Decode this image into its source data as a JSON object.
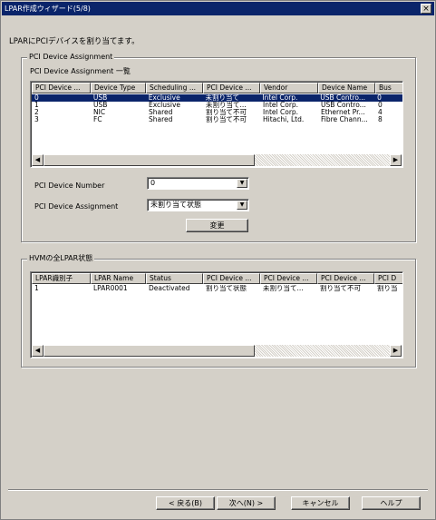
{
  "window": {
    "title": "LPAR作成ウィザード(5/8)",
    "close_glyph": "×"
  },
  "instruction": "LPARにPCIデバイスを割り当てます。",
  "pci_group": {
    "title": "PCI Device Assignment",
    "list_caption": "PCI Device Assignment 一覧",
    "columns": [
      "PCI Device ...",
      "Device Type",
      "Scheduling ...",
      "PCI Device ...",
      "Vendor",
      "Device Name",
      "Bus"
    ],
    "rows": [
      [
        "0",
        "USB",
        "Exclusive",
        "未割り当て",
        "Intel Corp.",
        "USB Contro...",
        "0"
      ],
      [
        "1",
        "USB",
        "Exclusive",
        "未割り当て...",
        "Intel Corp.",
        "USB Contro...",
        "0"
      ],
      [
        "2",
        "NIC",
        "Shared",
        "割り当て不可",
        "Intel Corp.",
        "Ethernet Pr...",
        "4"
      ],
      [
        "3",
        "FC",
        "Shared",
        "割り当て不可",
        "Hitachi, Ltd.",
        "Fibre Chann...",
        "8"
      ]
    ],
    "number_label": "PCI Device Number",
    "number_value": "0",
    "assignment_label": "PCI Device Assignment",
    "assignment_value": "未割り当て状態",
    "change_button": "変更"
  },
  "lpar_group": {
    "title": "HVMの全LPAR状態",
    "columns": [
      "LPAR識別子",
      "LPAR Name",
      "Status",
      "PCI Device ...",
      "PCI Device ...",
      "PCI Device ...",
      "PCI D"
    ],
    "rows": [
      [
        "1",
        "LPAR0001",
        "Deactivated",
        "割り当て状態",
        "未割り当て...",
        "割り当て不可",
        "割り当"
      ]
    ]
  },
  "footer": {
    "back": "< 戻る(B)",
    "next": "次へ(N) >",
    "cancel": "キャンセル",
    "help": "ヘルプ"
  },
  "colors": {
    "titlebar": "#0a246a",
    "face": "#d4d0c8",
    "selection": "#0a246a"
  }
}
